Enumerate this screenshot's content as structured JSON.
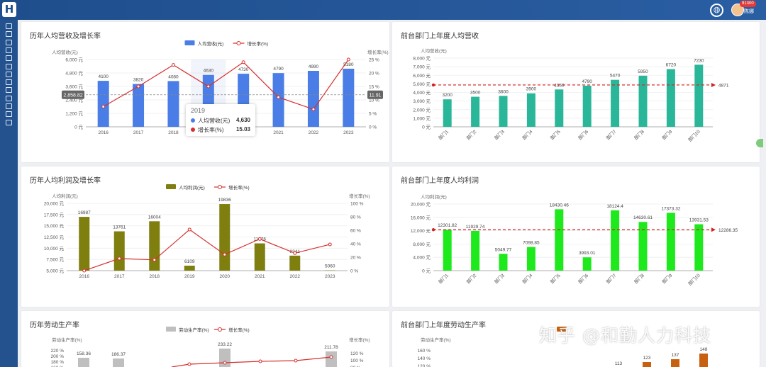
{
  "header": {
    "logo_text": "H",
    "badge": "91300",
    "user_name": "陈娜",
    "icons": [
      "logo-icon",
      "globe-icon",
      "avatar-icon"
    ]
  },
  "sidebar": {
    "icons": [
      "folder-icon",
      "chart-icon",
      "id-card-icon",
      "image-icon",
      "book-icon",
      "check-icon",
      "table-icon",
      "table-icon",
      "table-icon",
      "table-icon",
      "table-icon",
      "table-icon",
      "table-icon"
    ]
  },
  "watermark": "知乎 @和勤人力科技",
  "tooltip": {
    "title": "2019",
    "rows": [
      {
        "label": "人均营收(元)",
        "value": "4,630"
      },
      {
        "label": "增长率(%)",
        "value": "15.03"
      }
    ]
  },
  "chart_data": [
    {
      "type": "bar+line",
      "title": "历年人均营收及增长率",
      "ylabel": "人均营收(元)",
      "y2label": "增长率(%)",
      "categories": [
        "2016",
        "2017",
        "2018",
        "2019",
        "2020",
        "2021",
        "2022",
        "2023"
      ],
      "series": [
        {
          "name": "人均营收(元)",
          "type": "bar",
          "values": [
            4100,
            3820,
            4080,
            4630,
            4730,
            4790,
            4990,
            5180
          ],
          "labels": [
            "4100",
            "3820",
            "4080",
            "4630",
            "4730",
            "4790",
            "4990",
            "5180"
          ]
        },
        {
          "name": "增长率(%)",
          "type": "line",
          "axis": "right",
          "values": [
            7.5,
            15,
            23,
            15,
            24,
            11,
            6.5,
            25
          ]
        }
      ],
      "ylim": [
        0,
        6000
      ],
      "yticks": [
        "0 元",
        "1,200 元",
        "2,400 元",
        "3,600 元",
        "4,800 元",
        "6,000 元"
      ],
      "y2lim": [
        0,
        25
      ],
      "y2ticks": [
        "0 %",
        "5 %",
        "10 %",
        "15 %",
        "20 %",
        "25 %"
      ],
      "axis_pointer": {
        "y_value": "2,858.82",
        "y2_value": "11.91",
        "x_value": "2019"
      },
      "legend": "top-center"
    },
    {
      "type": "bar",
      "title": "前台部门上年度人均营收",
      "ylabel": "人均营收(元)",
      "categories": [
        "部门1",
        "部门2",
        "部门3",
        "部门4",
        "部门5",
        "部门6",
        "部门7",
        "部门8",
        "部门9",
        "部门10"
      ],
      "values": [
        3200,
        3500,
        3600,
        3900,
        4350,
        4790,
        5470,
        5950,
        6720,
        7230
      ],
      "labels": [
        "3200",
        "3500",
        "3600",
        "3900",
        "4350",
        "4790",
        "5470",
        "5950",
        "6720",
        "7230"
      ],
      "ylim": [
        0,
        8000
      ],
      "yticks": [
        "0 元",
        "1,000 元",
        "2,000 元",
        "3,000 元",
        "4,000 元",
        "5,000 元",
        "6,000 元",
        "7,000 元",
        "8,000 元"
      ],
      "mark_line": {
        "value": 4871,
        "label": "4871"
      },
      "color": "#2ab799"
    },
    {
      "type": "bar+line",
      "title": "历年人均利润及增长率",
      "ylabel": "人均利润(元)",
      "y2label": "增长率(%)",
      "categories": [
        "2016",
        "2017",
        "2018",
        "2019",
        "2020",
        "2021",
        "2022",
        "2023"
      ],
      "series": [
        {
          "name": "人均利润(元)",
          "type": "bar",
          "values": [
            16987,
            13761,
            16004,
            6109,
            19836,
            11076,
            8341,
            5060
          ],
          "labels": [
            "16987",
            "13761",
            "16004",
            "6109",
            "19836",
            "11076",
            "8341",
            "5060"
          ]
        },
        {
          "name": "增长率(%)",
          "type": "line",
          "axis": "right",
          "values": [
            0,
            18,
            16,
            61,
            24,
            47,
            26,
            39
          ]
        }
      ],
      "ylim": [
        5000,
        20000
      ],
      "yticks": [
        "5,000 元",
        "7,500 元",
        "10,000 元",
        "12,500 元",
        "15,000 元",
        "17,500 元",
        "20,000 元"
      ],
      "y2lim": [
        0,
        100
      ],
      "y2ticks": [
        "0 %",
        "20 %",
        "40 %",
        "60 %",
        "80 %",
        "100 %"
      ],
      "legend": "top-center"
    },
    {
      "type": "bar",
      "title": "前台部门上年度人均利润",
      "ylabel": "人均利润(元)",
      "categories": [
        "部门1",
        "部门2",
        "部门3",
        "部门4",
        "部门5",
        "部门6",
        "部门7",
        "部门8",
        "部门9",
        "部门10"
      ],
      "values": [
        12301.82,
        11929.74,
        5049.77,
        7098.85,
        18430.46,
        3993.01,
        18124.4,
        14630.61,
        17373.32,
        13931.53
      ],
      "labels": [
        "12301.82",
        "11929.74",
        "5049.77",
        "7098.85",
        "18430.46",
        "3993.01",
        "18124.4",
        "14630.61",
        "17373.32",
        "13931.53"
      ],
      "ylim": [
        0,
        20000
      ],
      "yticks": [
        "0 元",
        "4,000 元",
        "8,000 元",
        "12,000 元",
        "16,000 元",
        "20,000 元"
      ],
      "mark_line": {
        "value": 12286.35,
        "label": "12286.35"
      },
      "color": "#1de91d"
    },
    {
      "type": "bar+line",
      "title": "历年劳动生产率",
      "ylabel": "劳动生产率(%)",
      "y2label": "增长率(%)",
      "series_names": [
        "劳动生产率(%)",
        "增长率(%)"
      ],
      "bar_labels": [
        "158.36",
        "186.37",
        "233.22",
        "211.78"
      ],
      "yticks": [
        "160 %",
        "180 %",
        "200 %",
        "220 %"
      ],
      "y2ticks": [
        "80 %",
        "100 %",
        "120 %"
      ],
      "legend": "top-center"
    },
    {
      "type": "bar",
      "title": "前台部门上年度劳动生产率",
      "ylabel": "劳动生产率(%)",
      "labels": [
        "113",
        "123",
        "137",
        "148"
      ],
      "yticks": [
        "120 %",
        "140 %",
        "160 %"
      ]
    }
  ]
}
